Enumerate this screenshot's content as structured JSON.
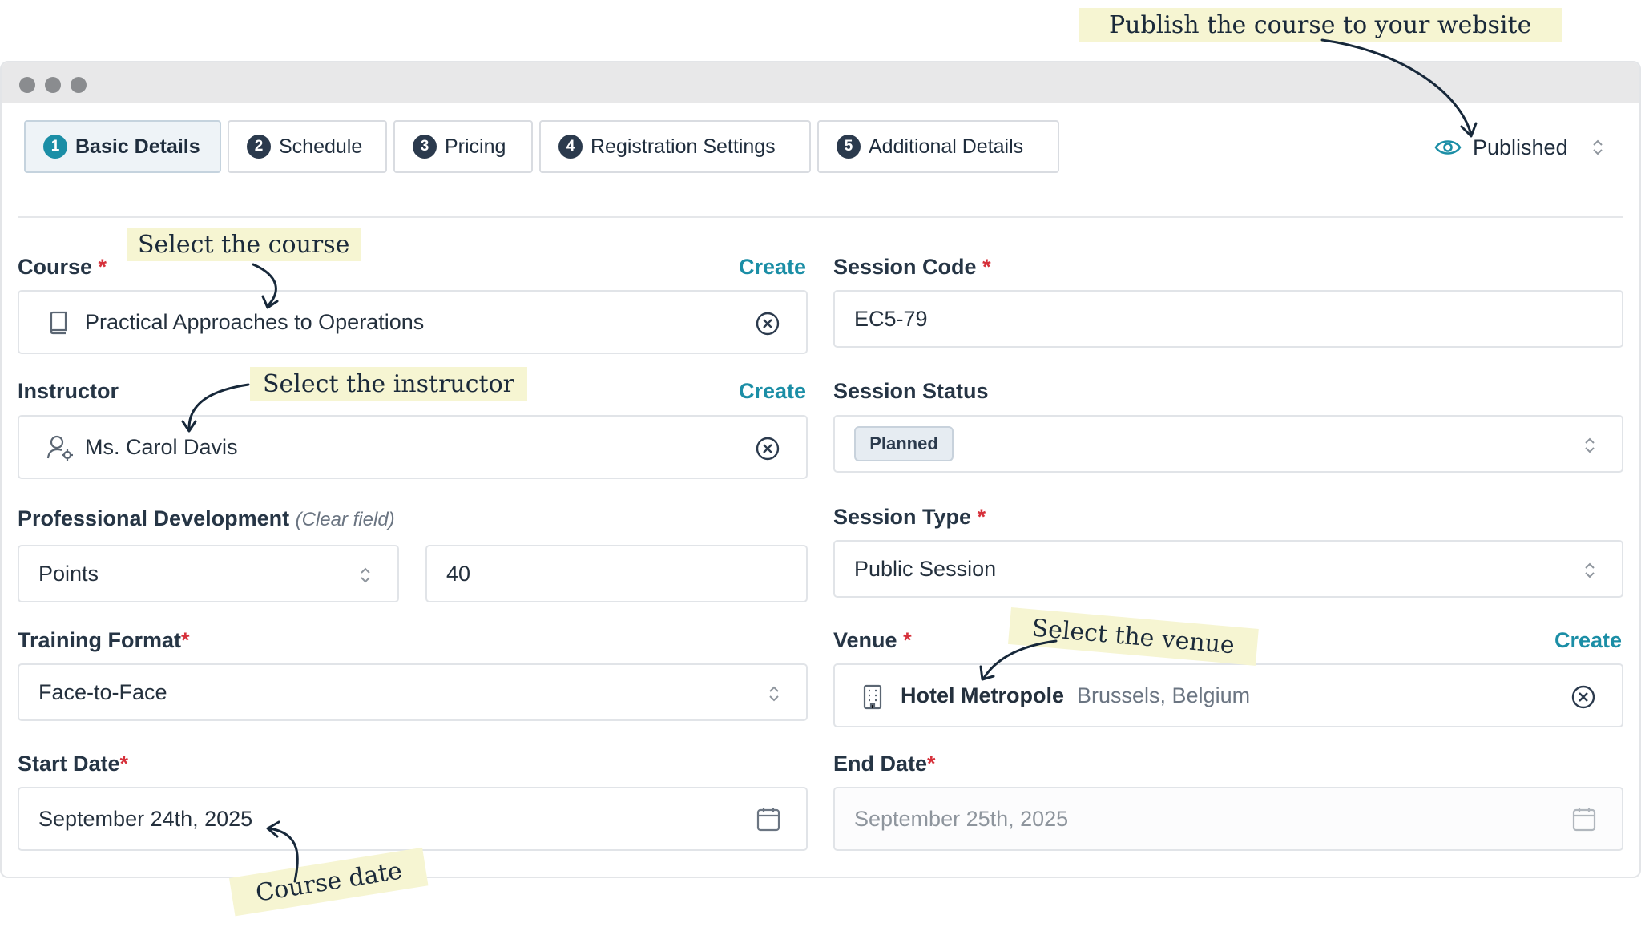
{
  "annotations": {
    "publish": "Publish the course to your website",
    "course": "Select the course",
    "instructor": "Select the instructor",
    "venue": "Select the venue",
    "date": "Course date"
  },
  "tabs": [
    {
      "num": "1",
      "label": "Basic Details"
    },
    {
      "num": "2",
      "label": "Schedule"
    },
    {
      "num": "3",
      "label": "Pricing"
    },
    {
      "num": "4",
      "label": "Registration Settings"
    },
    {
      "num": "5",
      "label": "Additional Details"
    }
  ],
  "publish_status": "Published",
  "create_label": "Create",
  "required_mark": "*",
  "fields": {
    "course": {
      "label": "Course",
      "value": "Practical Approaches to Operations"
    },
    "instructor": {
      "label": "Instructor",
      "value": "Ms. Carol Davis"
    },
    "professional_development": {
      "label": "Professional Development",
      "hint": "(Clear field)",
      "unit": "Points",
      "amount": "40"
    },
    "training_format": {
      "label": "Training Format",
      "value": "Face-to-Face"
    },
    "start_date": {
      "label": "Start Date",
      "value": "September 24th, 2025"
    },
    "session_code": {
      "label": "Session Code",
      "value": "EC5-79"
    },
    "session_status": {
      "label": "Session Status",
      "value": "Planned"
    },
    "session_type": {
      "label": "Session Type",
      "value": "Public Session"
    },
    "venue": {
      "label": "Venue",
      "name": "Hotel Metropole",
      "location": "Brussels, Belgium"
    },
    "end_date": {
      "label": "End Date",
      "value": "September 25th, 2025"
    }
  },
  "colors": {
    "accent": "#1b8ea6",
    "required": "#d6303a",
    "annotation_bg": "#f6f5d2"
  },
  "icons": [
    "eye-icon",
    "book-icon",
    "user-gear-icon",
    "clear-icon",
    "chevron-updown-icon",
    "building-icon",
    "calendar-icon"
  ]
}
